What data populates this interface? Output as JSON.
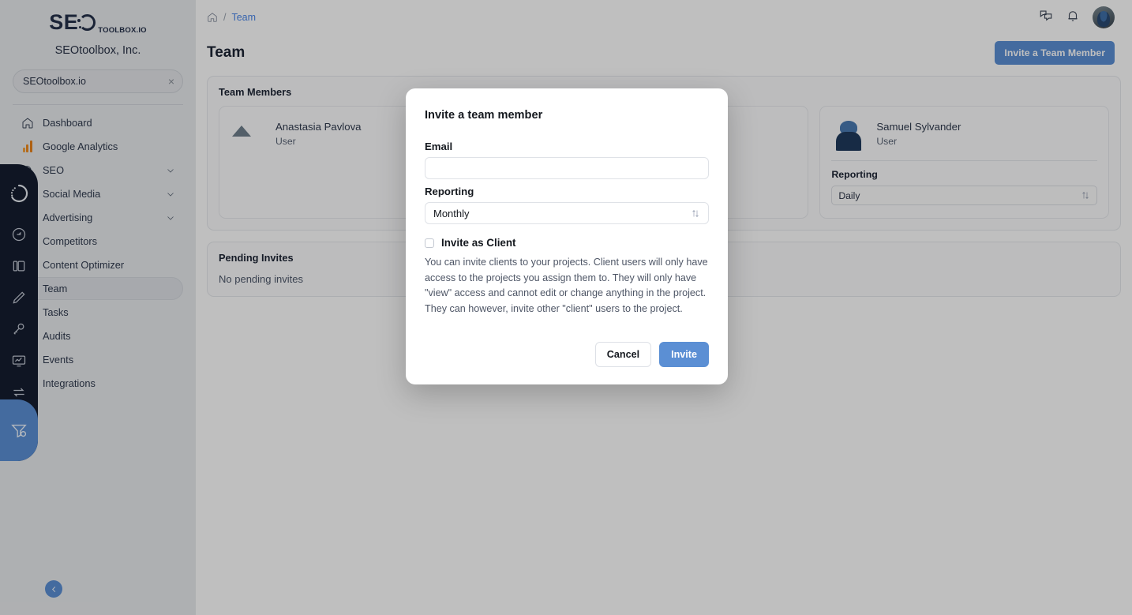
{
  "app": {
    "brand_main": "SE",
    "brand_sub": "TOOLBOX.IO",
    "org_name": "SEOtoolbox, Inc."
  },
  "sidebar": {
    "site_selector": {
      "value": "SEOtoolbox.io",
      "clear_label": "×"
    },
    "items": [
      {
        "label": "Dashboard",
        "icon": "home-icon",
        "expandable": false,
        "active": false
      },
      {
        "label": "Google Analytics",
        "icon": "bar-chart-icon",
        "expandable": false,
        "active": false
      },
      {
        "label": "SEO",
        "icon": "search-icon",
        "expandable": true,
        "active": false
      },
      {
        "label": "Social Media",
        "icon": "chat-icon",
        "expandable": true,
        "active": false
      },
      {
        "label": "Advertising",
        "icon": "megaphone-icon",
        "expandable": true,
        "active": false
      },
      {
        "label": "Competitors",
        "icon": "boxing-glove-icon",
        "expandable": false,
        "active": false
      },
      {
        "label": "Content Optimizer",
        "icon": "pencil-icon",
        "expandable": false,
        "active": false
      },
      {
        "label": "Team",
        "icon": "users-icon",
        "expandable": false,
        "active": true
      },
      {
        "label": "Tasks",
        "icon": "checklist-icon",
        "expandable": false,
        "active": false
      },
      {
        "label": "Audits",
        "icon": "monitor-chart-icon",
        "expandable": false,
        "active": false
      },
      {
        "label": "Events",
        "icon": "calendar-icon",
        "expandable": false,
        "active": false
      },
      {
        "label": "Integrations",
        "icon": "grid-plus-icon",
        "expandable": false,
        "active": false
      }
    ]
  },
  "icon_rail": {
    "logo_icon": "dotted-circle-logo-icon",
    "items": [
      {
        "icon": "speedometer-icon"
      },
      {
        "icon": "panels-icon"
      },
      {
        "icon": "pencil-icon"
      },
      {
        "icon": "key-icon"
      },
      {
        "icon": "monitor-chart-icon"
      },
      {
        "icon": "transfer-arrows-icon"
      }
    ],
    "bottom_item": {
      "icon": "funnel-filter-icon",
      "highlighted": true
    }
  },
  "topbar": {
    "breadcrumb": {
      "home_icon": "home-icon",
      "separator": "/",
      "current": "Team"
    },
    "icons": [
      {
        "name": "chat-bubbles-icon"
      },
      {
        "name": "bell-icon"
      }
    ],
    "avatar": "user-avatar"
  },
  "page": {
    "title": "Team",
    "invite_button": "Invite a Team Member"
  },
  "team_members_panel": {
    "title": "Team Members",
    "members": [
      {
        "name": "Anastasia Pavlova",
        "role": "User",
        "avatar": "mountain-landscape-avatar",
        "reporting_label": "",
        "reporting_value": "",
        "show_reporting": false
      },
      {
        "name": "",
        "role": "",
        "avatar": "",
        "reporting_label": "",
        "reporting_value": "",
        "show_reporting": false
      },
      {
        "name": "Samuel Sylvander",
        "role": "User",
        "avatar": "hiker-photo-avatar",
        "reporting_label": "Reporting",
        "reporting_value": "Daily",
        "show_reporting": true
      }
    ]
  },
  "pending_invites_panel": {
    "title": "Pending Invites",
    "empty_message": "No pending invites"
  },
  "modal": {
    "title": "Invite a team member",
    "email_label": "Email",
    "email_value": "",
    "email_placeholder": "",
    "reporting_label": "Reporting",
    "reporting_value": "Monthly",
    "checkbox_label": "Invite as Client",
    "checkbox_checked": false,
    "help_text": "You can invite clients to your projects. Client users will only have access to the projects you assign them to. They will only have \"view\" access and cannot edit or change anything in the project. They can however, invite other \"client\" users to the project.",
    "cancel_label": "Cancel",
    "invite_label": "Invite"
  },
  "collapse_button": {
    "icon": "chevron-left-icon"
  },
  "colors": {
    "accent_blue": "#5b8fd4",
    "sidebar_bg": "#e9ebee",
    "rail_dark": "#141d2f",
    "link_blue": "#4a86e8"
  }
}
